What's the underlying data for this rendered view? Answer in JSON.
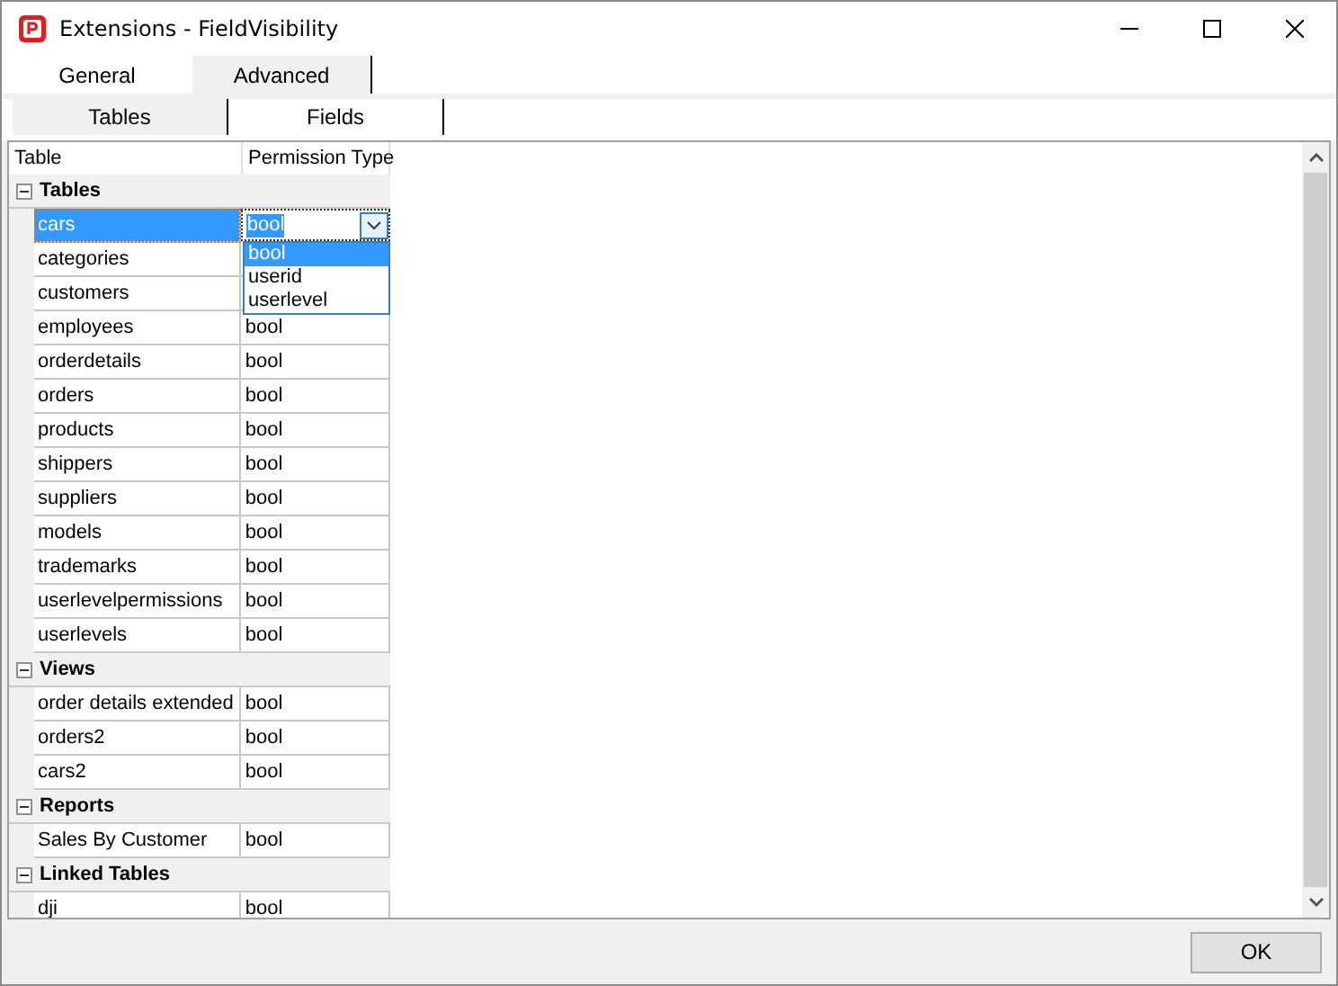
{
  "window": {
    "title": "Extensions - FieldVisibility"
  },
  "tabs": [
    {
      "label": "General",
      "selected": false
    },
    {
      "label": "Advanced",
      "selected": true
    }
  ],
  "subtabs": [
    {
      "label": "Tables",
      "selected": true
    },
    {
      "label": "Fields",
      "selected": false
    }
  ],
  "table": {
    "columns": [
      "Table",
      "Permission Type"
    ],
    "groups": [
      {
        "name": "Tables",
        "expanded": true,
        "rows": [
          {
            "table": "cars",
            "permission": "bool",
            "selected": true,
            "editing": true,
            "dropdown": [
              {
                "label": "bool",
                "selected": true
              },
              {
                "label": "userid",
                "selected": false
              },
              {
                "label": "userlevel",
                "selected": false
              }
            ]
          },
          {
            "table": "categories",
            "selected": false
          },
          {
            "table": "customers",
            "selected": false
          },
          {
            "table": "employees",
            "permission": "bool",
            "selected": false
          },
          {
            "table": "orderdetails",
            "permission": "bool",
            "selected": false
          },
          {
            "table": "orders",
            "permission": "bool",
            "selected": false
          },
          {
            "table": "products",
            "permission": "bool",
            "selected": false
          },
          {
            "table": "shippers",
            "permission": "bool",
            "selected": false
          },
          {
            "table": "suppliers",
            "permission": "bool",
            "selected": false
          },
          {
            "table": "models",
            "permission": "bool",
            "selected": false
          },
          {
            "table": "trademarks",
            "permission": "bool",
            "selected": false
          },
          {
            "table": "userlevelpermissions",
            "permission": "bool",
            "selected": false
          },
          {
            "table": "userlevels",
            "permission": "bool",
            "selected": false
          }
        ]
      },
      {
        "name": "Views",
        "expanded": true,
        "rows": [
          {
            "table": "order details extended",
            "permission": "bool",
            "selected": false
          },
          {
            "table": "orders2",
            "permission": "bool",
            "selected": false
          },
          {
            "table": "cars2",
            "permission": "bool",
            "selected": false
          }
        ]
      },
      {
        "name": "Reports",
        "expanded": true,
        "rows": [
          {
            "table": "Sales By Customer",
            "permission": "bool",
            "selected": false
          }
        ]
      },
      {
        "name": "Linked Tables",
        "expanded": true,
        "rows": [
          {
            "table": "dji",
            "permission": "bool",
            "selected": false
          }
        ]
      }
    ]
  },
  "buttons": [
    {
      "label": "OK"
    }
  ]
}
